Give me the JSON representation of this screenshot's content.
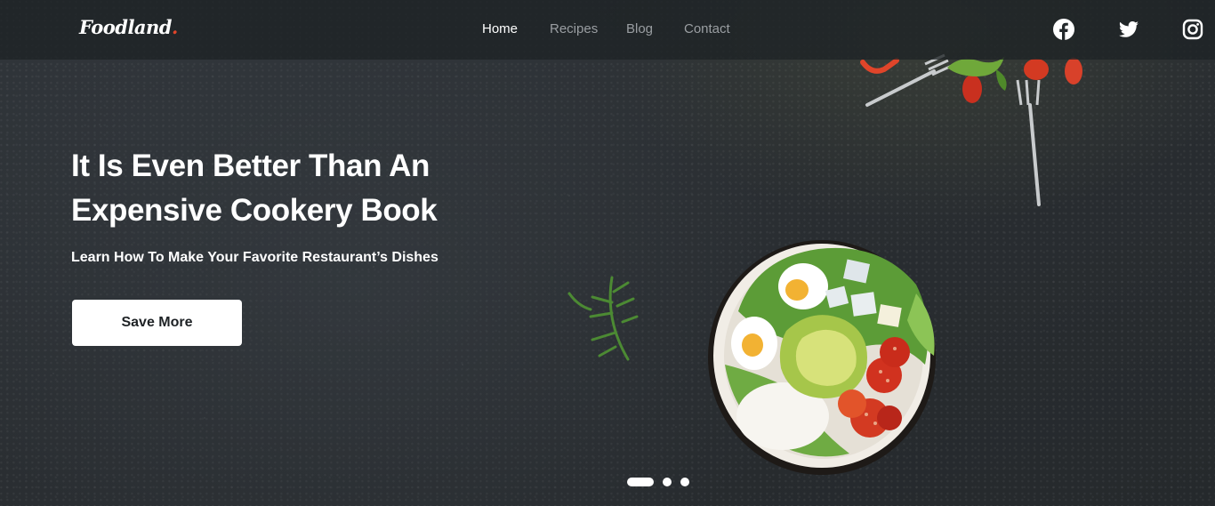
{
  "brand": {
    "name": "Foodland",
    "dot": "."
  },
  "nav": {
    "items": [
      {
        "label": "Home",
        "active": true
      },
      {
        "label": "Recipes",
        "active": false
      },
      {
        "label": "Blog",
        "active": false
      },
      {
        "label": "Contact",
        "active": false
      }
    ]
  },
  "social": [
    {
      "icon": "facebook-icon"
    },
    {
      "icon": "twitter-icon"
    },
    {
      "icon": "instagram-icon"
    }
  ],
  "hero": {
    "headline": "It Is Even Better Than An Expensive Cookery Book",
    "subline": "Learn How To Make Your Favorite Restaurant’s Dishes",
    "cta_label": "Save More"
  },
  "slider": {
    "count": 3,
    "active_index": 0
  },
  "colors": {
    "accent": "#e0452a",
    "background": "#2e3236",
    "text": "#ffffff",
    "nav_inactive": "#9a9ea2"
  }
}
